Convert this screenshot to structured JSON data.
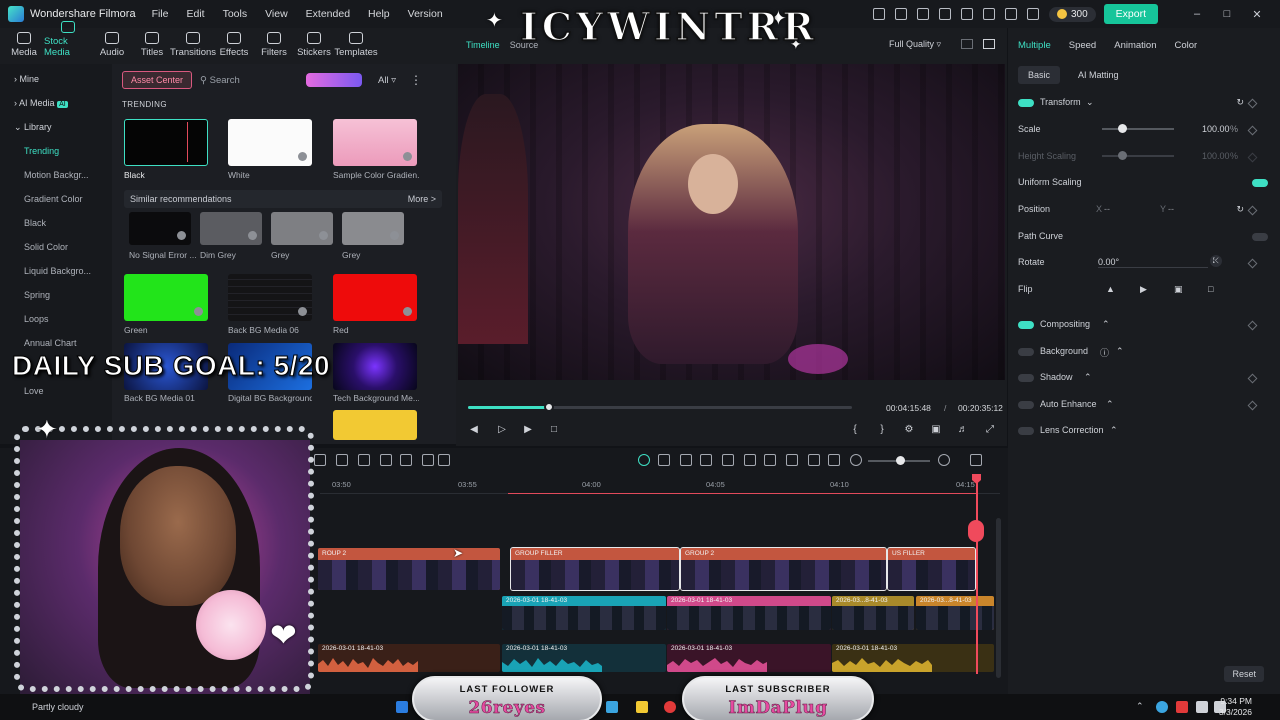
{
  "app": {
    "name": "Wondershare Filmora",
    "menu": [
      "File",
      "Edit",
      "Tools",
      "View",
      "Extended",
      "Help",
      "Version"
    ],
    "credits": "300",
    "export_label": "Export"
  },
  "toolbar": [
    "Media",
    "Stock Media",
    "Audio",
    "Titles",
    "Transitions",
    "Effects",
    "Filters",
    "Stickers",
    "Templates"
  ],
  "sidebar": {
    "items": [
      "Mine",
      "AI Media",
      "Library",
      "Trending",
      "Motion Backgr...",
      "Gradient Color",
      "Black",
      "Solid Color",
      "Liquid Backgro...",
      "Spring",
      "Loops",
      "Annual Chart",
      "Love"
    ],
    "ai_badge": "AI"
  },
  "browser": {
    "asset_center": "Asset Center",
    "search_placeholder": "Search",
    "filter_label": "All",
    "section": "TRENDING",
    "similar_label": "Similar recommendations",
    "more_label": "More >",
    "tiles": [
      "Black",
      "White",
      "Sample Color Gradien...",
      "No Signal Error ...",
      "Dim Grey",
      "Grey",
      "Grey",
      "Green",
      "Back BG Media 06",
      "Red",
      "Back BG Media 01",
      "Digital BG Background",
      "Tech Background Me..."
    ]
  },
  "preview": {
    "tabs": [
      "Timeline",
      "Source"
    ],
    "quality": "Full Quality",
    "current_time": "00:04:15:48",
    "separator": "/",
    "total_time": "00:20:35:12",
    "progress": 0.21
  },
  "inspector": {
    "tabs": [
      "Multiple",
      "Speed",
      "Animation",
      "Color"
    ],
    "subtabs": [
      "Basic",
      "AI Matting"
    ],
    "transform": "Transform",
    "scale_label": "Scale",
    "scale_value": "100.00",
    "scale_unit": "%",
    "height_scaling": "Height Scaling",
    "height_value": "100.00",
    "uniform_scaling": "Uniform Scaling",
    "position": "Position",
    "pos_x_label": "X",
    "pos_x": "--",
    "pos_y_label": "Y",
    "pos_y": "--",
    "path_curve": "Path Curve",
    "rotate": "Rotate",
    "rotate_value": "0.00°",
    "flip": "Flip",
    "compositing": "Compositing",
    "background": "Background",
    "shadow": "Shadow",
    "auto_enhance": "Auto Enhance",
    "lens_correction": "Lens Correction",
    "reset": "Reset"
  },
  "timeline": {
    "ruler": [
      "03:50",
      "03:55",
      "04:00",
      "04:05",
      "04:10",
      "04:15"
    ],
    "group_clips": [
      "ROUP 2",
      "GROUP FILLER",
      "GROUP 2",
      "US FILLER"
    ],
    "video_clips": [
      "2026-03-01 18-41-03",
      "2026-03-01 18-41-03",
      "2026-03...8-41-03",
      "2026-03...8-41-03"
    ],
    "audio_clips": [
      "2026-03-01 18-41-03",
      "2026-03-01 18-41-03",
      "2026-03-01 18-41-03",
      "2026-03-01 18-41-03"
    ]
  },
  "overlay": {
    "brand": "ICYWINTRR",
    "goal": "DAILY SUB GOAL: 5/20",
    "last_follower_title": "LAST FOLLOWER",
    "last_follower": "26reyes",
    "last_subscriber_title": "LAST SUBSCRIBER",
    "last_subscriber": "ImDaPlug"
  },
  "taskbar": {
    "weather": "Partly cloudy",
    "time": "9:34 PM",
    "date": "3/3/2026"
  },
  "colors": {
    "accent": "#3ee0c4",
    "export": "#16c59a",
    "playhead": "#f04a5c"
  }
}
